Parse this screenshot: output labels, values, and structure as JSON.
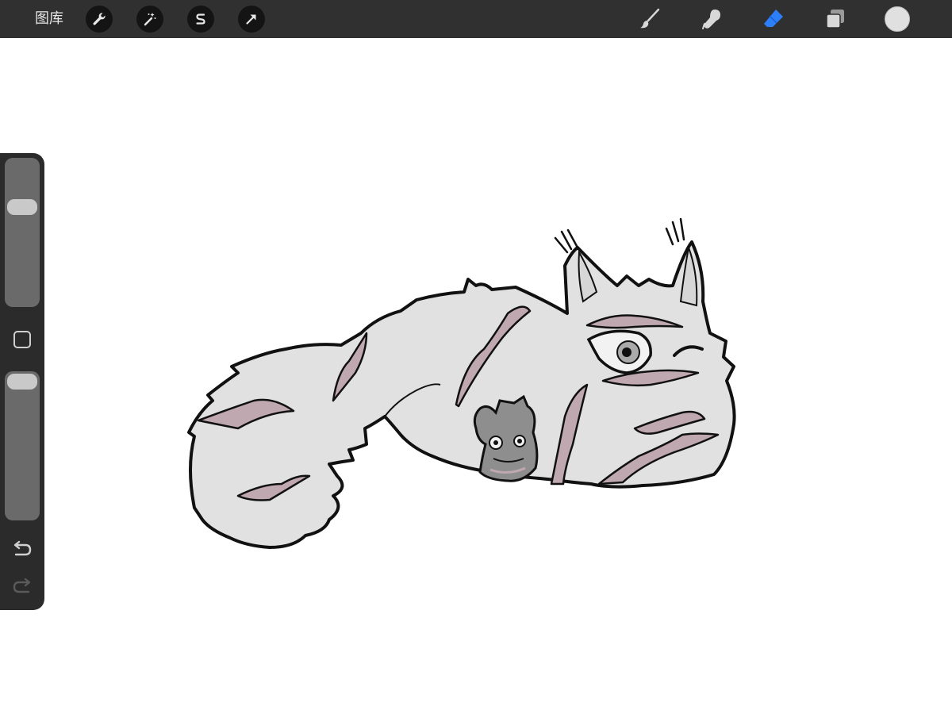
{
  "toolbar": {
    "gallery_label": "图库",
    "left_tools": [
      {
        "name": "actions",
        "icon": "wrench-icon"
      },
      {
        "name": "adjustments",
        "icon": "magic-wand-icon"
      },
      {
        "name": "selection",
        "icon": "selection-s-icon"
      },
      {
        "name": "transform",
        "icon": "arrow-cursor-icon"
      }
    ],
    "right_tools": [
      {
        "name": "brush",
        "icon": "brush-icon",
        "active": false
      },
      {
        "name": "smudge",
        "icon": "smudge-icon",
        "active": false
      },
      {
        "name": "eraser",
        "icon": "eraser-icon",
        "active": true
      },
      {
        "name": "layers",
        "icon": "layers-icon",
        "active": false
      }
    ],
    "current_color": "#e0e0e0"
  },
  "sidebar": {
    "brush_size_level": 0.7,
    "opacity_level": 1.0,
    "modify_icon": "square-icon",
    "undo_icon": "undo-icon",
    "redo_icon": "redo-icon",
    "redo_enabled": false
  },
  "colors": {
    "toolbar_bg": "#303030",
    "sidebar_bg": "#2b2b2b",
    "accent_active": "#2d7ff9",
    "fur_fill": "#e1e1e1",
    "stripe_fill": "#bfa8b0",
    "outline": "#111111"
  }
}
